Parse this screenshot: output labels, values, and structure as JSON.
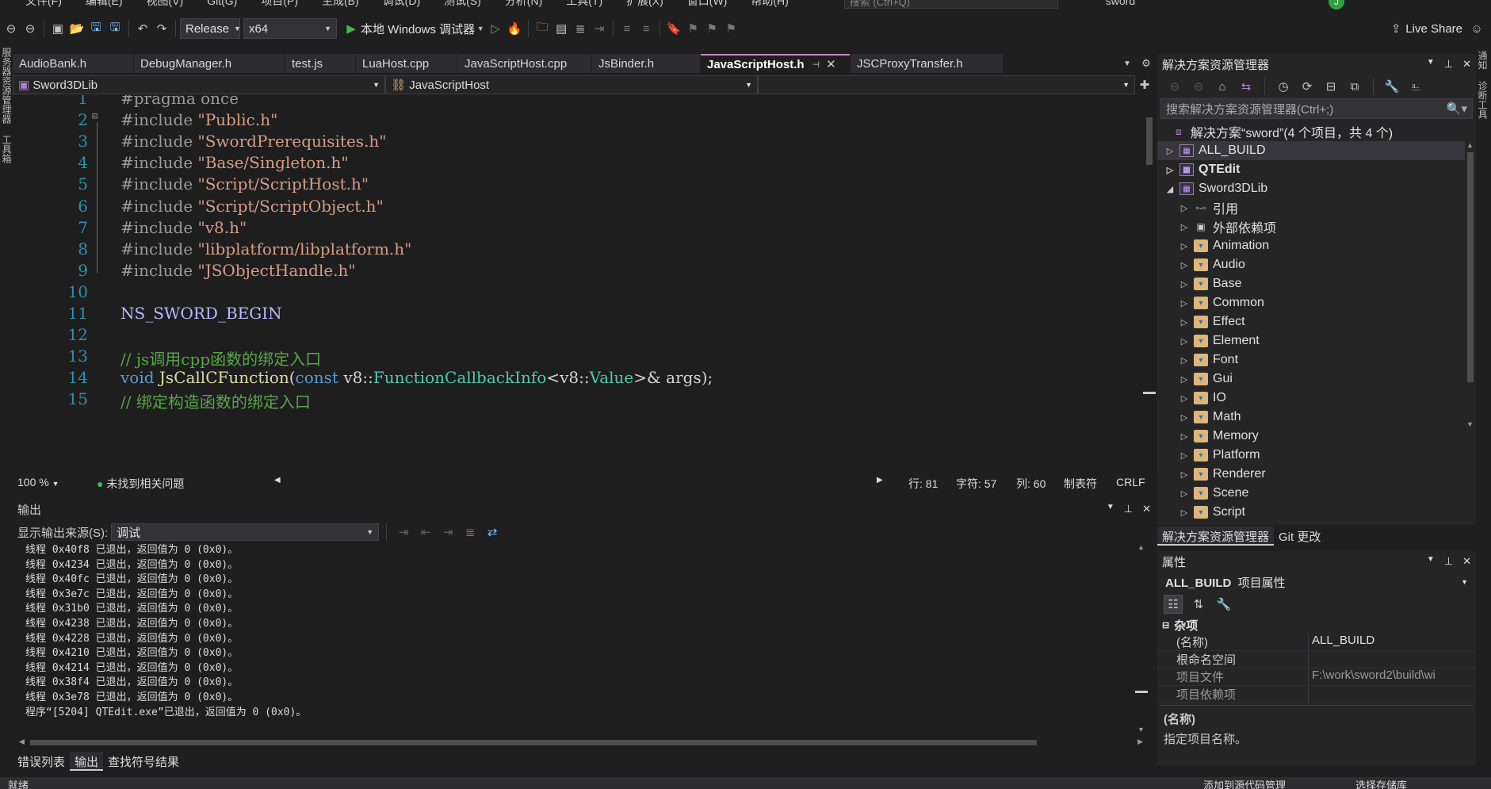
{
  "menu": {
    "items": [
      "文件(F)",
      "编辑(E)",
      "视图(V)",
      "Git(G)",
      "项目(P)",
      "生成(B)",
      "调试(D)",
      "测试(S)",
      "分析(N)",
      "工具(T)",
      "扩展(X)",
      "窗口(W)",
      "帮助(H)"
    ],
    "search_placeholder": "搜索 (Ctrl+Q)",
    "solution_title": "sword"
  },
  "toolbar": {
    "config": "Release",
    "platform": "x64",
    "debugger": "本地 Windows 调试器",
    "avatar_initial": "J",
    "live_share": "Live Share"
  },
  "left_strip": [
    "服务器资源管理器",
    "工具箱"
  ],
  "right_strip": [
    "通知",
    "诊断工具"
  ],
  "doc_tabs": [
    {
      "label": "AudioBank.h"
    },
    {
      "label": "DebugManager.h"
    },
    {
      "label": "test.js"
    },
    {
      "label": "LuaHost.cpp"
    },
    {
      "label": "JavaScriptHost.cpp"
    },
    {
      "label": "JsBinder.h"
    },
    {
      "label": "JavaScriptHost.h"
    },
    {
      "label": "JSCProxyTransfer.h"
    }
  ],
  "nav": {
    "project": "Sword3DLib",
    "scope": "JavaScriptHost",
    "member": ""
  },
  "editor": {
    "lines": [
      {
        "n": "1",
        "html": "<span class=\"pp\">#pragma once</span>"
      },
      {
        "n": "2",
        "html": "<span class=\"pp\">#include </span><span class=\"str\">\"Public.h\"</span>"
      },
      {
        "n": "3",
        "html": "<span class=\"pp\">#include </span><span class=\"str\">\"SwordPrerequisites.h\"</span>"
      },
      {
        "n": "4",
        "html": "<span class=\"pp\">#include </span><span class=\"str\">\"Base/Singleton.h\"</span>"
      },
      {
        "n": "5",
        "html": "<span class=\"pp\">#include </span><span class=\"str\">\"Script/ScriptHost.h\"</span>"
      },
      {
        "n": "6",
        "html": "<span class=\"pp\">#include </span><span class=\"str\">\"Script/ScriptObject.h\"</span>"
      },
      {
        "n": "7",
        "html": "<span class=\"pp\">#include </span><span class=\"str\">\"v8.h\"</span>"
      },
      {
        "n": "8",
        "html": "<span class=\"pp\">#include </span><span class=\"str\">\"libplatform/libplatform.h\"</span>"
      },
      {
        "n": "9",
        "html": "<span class=\"pp\">#include </span><span class=\"str\">\"JSObjectHandle.h\"</span>"
      },
      {
        "n": "10",
        "html": ""
      },
      {
        "n": "11",
        "html": "<span class=\"mac\">NS_SWORD_BEGIN</span>"
      },
      {
        "n": "12",
        "html": ""
      },
      {
        "n": "13",
        "html": "<span class=\"cm\">// js调用cpp函数的绑定入口</span>"
      },
      {
        "n": "14",
        "html": "<span class=\"kw\">void</span> <span class=\"fn\">JsCallCFunction</span>(<span class=\"kw\">const</span> v8::<span class=\"ty\">FunctionCallbackInfo</span>&lt;v8::<span class=\"ty\">Value</span>&gt;&amp; args);"
      },
      {
        "n": "15",
        "html": "<span class=\"cm\">// 绑定构造函数的绑定入口</span>"
      }
    ]
  },
  "editor_status": {
    "zoom": "100 %",
    "issues": "未找到相关问题",
    "line": "行: 81",
    "char": "字符: 57",
    "col": "列: 60",
    "tabs": "制表符",
    "eol": "CRLF"
  },
  "output": {
    "title": "输出",
    "source_label": "显示输出来源(S):",
    "source_value": "调试",
    "lines": [
      "线程 0x40f8 已退出，返回值为 0 (0x0)。",
      "线程 0x4234 已退出，返回值为 0 (0x0)。",
      "线程 0x40fc 已退出，返回值为 0 (0x0)。",
      "线程 0x3e7c 已退出，返回值为 0 (0x0)。",
      "线程 0x31b0 已退出，返回值为 0 (0x0)。",
      "线程 0x4238 已退出，返回值为 0 (0x0)。",
      "线程 0x4228 已退出，返回值为 0 (0x0)。",
      "线程 0x4210 已退出，返回值为 0 (0x0)。",
      "线程 0x4214 已退出，返回值为 0 (0x0)。",
      "线程 0x38f4 已退出，返回值为 0 (0x0)。",
      "线程 0x3e78 已退出，返回值为 0 (0x0)。",
      "程序“[5204] QTEdit.exe”已退出，返回值为 0 (0x0)。"
    ]
  },
  "bottom_tabs": [
    "错误列表",
    "输出",
    "查找符号结果"
  ],
  "status_bar": {
    "ready": "就绪",
    "add_source": "添加到源代码管理",
    "select_repo": "选择存储库"
  },
  "solution_explorer": {
    "title": "解决方案资源管理器",
    "search_placeholder": "搜索解决方案资源管理器(Ctrl+;)",
    "root": "解决方案“sword”(4 个项目，共 4 个)",
    "projects": [
      "ALL_BUILD",
      "QTEdit",
      "Sword3DLib"
    ],
    "children": [
      "引用",
      "外部依赖项",
      "Animation",
      "Audio",
      "Base",
      "Common",
      "Effect",
      "Element",
      "Font",
      "Gui",
      "IO",
      "Math",
      "Memory",
      "Platform",
      "Renderer",
      "Scene",
      "Script"
    ],
    "tabs": [
      "解决方案资源管理器",
      "Git 更改"
    ]
  },
  "properties": {
    "title": "属性",
    "object": "ALL_BUILD",
    "object_type": "项目属性",
    "category": "杂项",
    "rows": [
      {
        "k": "(名称)",
        "v": "ALL_BUILD"
      },
      {
        "k": "根命名空间",
        "v": ""
      },
      {
        "k": "项目文件",
        "v": "F:\\work\\sword2\\build\\wi"
      },
      {
        "k": "项目依赖项",
        "v": ""
      }
    ],
    "desc_title": "(名称)",
    "desc_text": "指定项目名称。"
  }
}
